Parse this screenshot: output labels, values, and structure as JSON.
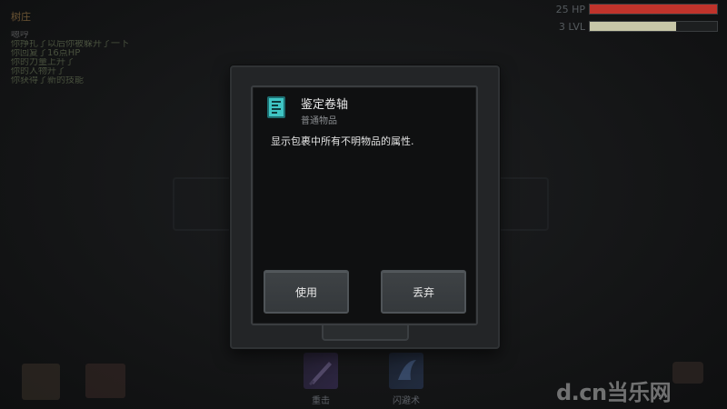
{
  "hud": {
    "location": "树庄",
    "log_title": "嗯哼",
    "log_lines": [
      "你挣扎了以后你被躲开了一下",
      "你回复了16点HP",
      "你的力量上升了",
      "你的人物升了",
      "你获得了新的技能"
    ],
    "hp": {
      "label": "25 HP",
      "fraction": 1.0,
      "color": "#c0332b"
    },
    "lvl": {
      "label": "3 LVL",
      "fraction": 0.68,
      "color": "#c7c7a8"
    }
  },
  "skills": {
    "strike_label": "重击",
    "dodge_label": "闪避术",
    "strike_icon": "strike-skill-icon",
    "dodge_icon": "dodge-skill-icon"
  },
  "item_dialog": {
    "icon": "scroll-icon",
    "name": "鉴定卷轴",
    "rarity": "普通物品",
    "description": "显示包裹中所有不明物品的属性.",
    "use_label": "使用",
    "drop_label": "丢弃",
    "icon_color": "#3fc5c4"
  },
  "watermark": "d.cn当乐网"
}
